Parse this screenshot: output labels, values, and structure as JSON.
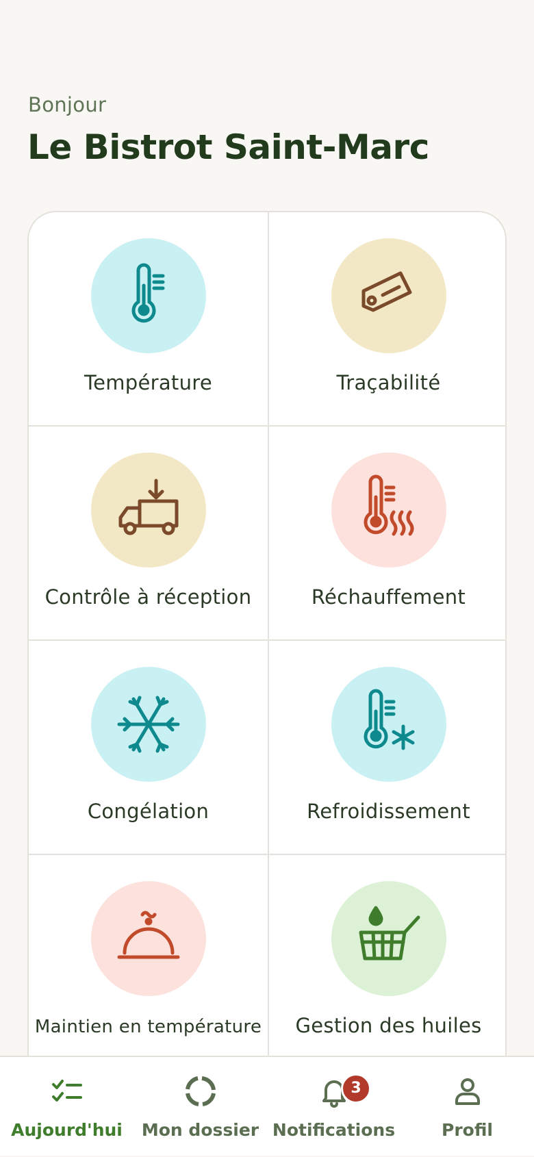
{
  "header": {
    "greeting": "Bonjour",
    "restaurant_name": "Le Bistrot Saint-Marc"
  },
  "tiles": [
    {
      "label": "Température",
      "icon": "thermometer-icon",
      "bg": "#c9f0f3"
    },
    {
      "label": "Traçabilité",
      "icon": "tag-icon",
      "bg": "#f3e8c6"
    },
    {
      "label": "Contrôle à réception",
      "icon": "delivery-truck-icon",
      "bg": "#f3e8c6"
    },
    {
      "label": "Réchauffement",
      "icon": "reheat-thermometer-icon",
      "bg": "#fde1dc"
    },
    {
      "label": "Congélation",
      "icon": "snowflake-icon",
      "bg": "#c9f0f3"
    },
    {
      "label": "Refroidissement",
      "icon": "cooling-thermometer-icon",
      "bg": "#c9f0f3"
    },
    {
      "label": "Maintien en température",
      "icon": "cloche-icon",
      "bg": "#fde1dc"
    },
    {
      "label": "Gestion des huiles",
      "icon": "fryer-basket-icon",
      "bg": "#dcf1d6"
    }
  ],
  "tabbar": {
    "tabs": [
      {
        "label": "Aujourd'hui",
        "icon": "checklist-icon",
        "active": true
      },
      {
        "label": "Mon dossier",
        "icon": "progress-ring-icon",
        "active": false
      },
      {
        "label": "Notifications",
        "icon": "bell-icon",
        "active": false,
        "badge": "3"
      },
      {
        "label": "Profil",
        "icon": "person-icon",
        "active": false
      }
    ]
  },
  "colors": {
    "accent_green": "#3f7d2d",
    "badge_red": "#b23a2a",
    "teal": "#0e8a8e",
    "brown": "#7a4a2a",
    "rust": "#c04a2a"
  }
}
